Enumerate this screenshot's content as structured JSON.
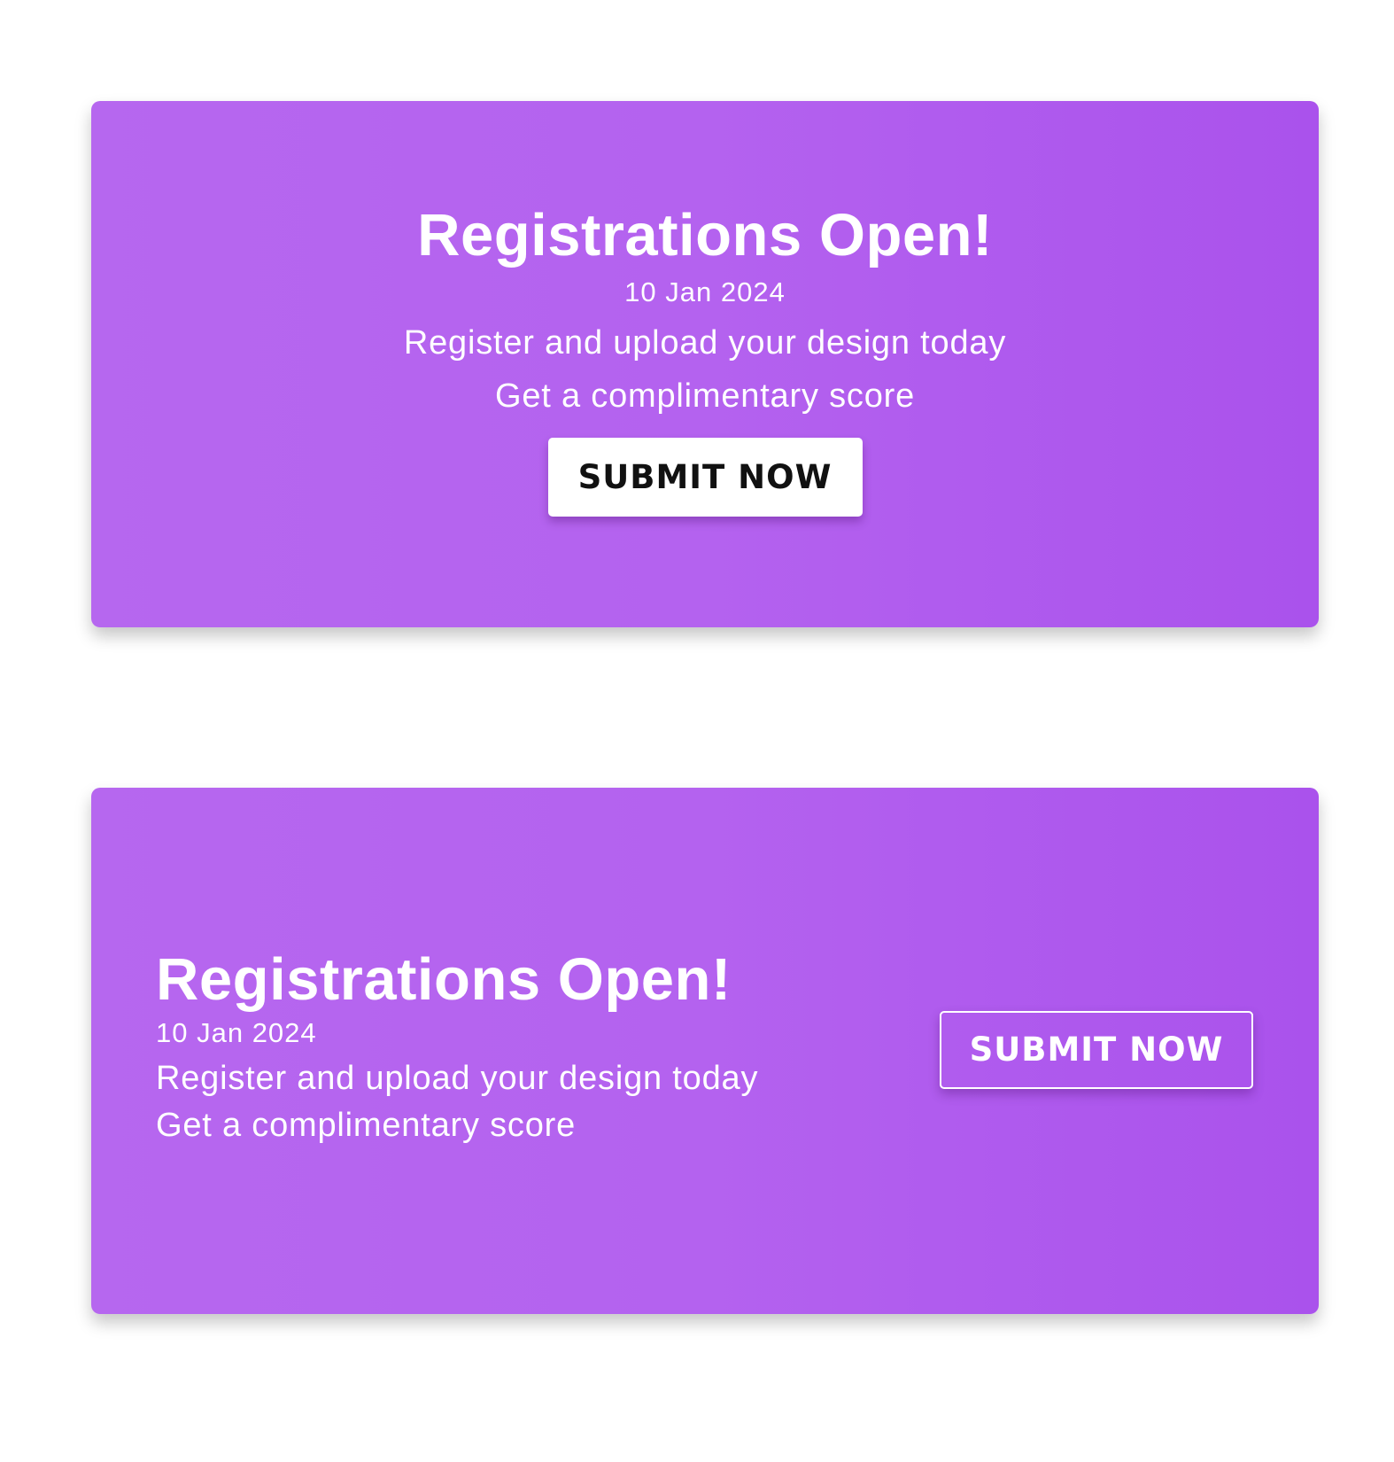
{
  "banners": [
    {
      "title": "Registrations Open!",
      "date": "10 Jan 2024",
      "line1": "Register and upload your design today",
      "line2": "Get a complimentary score",
      "button_label": "SUBMIT NOW",
      "alignment": "center",
      "button_style": "solid-white"
    },
    {
      "title": "Registrations Open!",
      "date": "10 Jan 2024",
      "line1": "Register and upload your design today",
      "line2": "Get a complimentary score",
      "button_label": "SUBMIT NOW",
      "alignment": "left",
      "button_style": "outline-white"
    }
  ],
  "colors": {
    "banner_gradient_start": "#b667ef",
    "banner_gradient_end": "#aa52ec",
    "text": "#ffffff",
    "button_text_dark": "#111111",
    "page_background": "#ffffff"
  }
}
